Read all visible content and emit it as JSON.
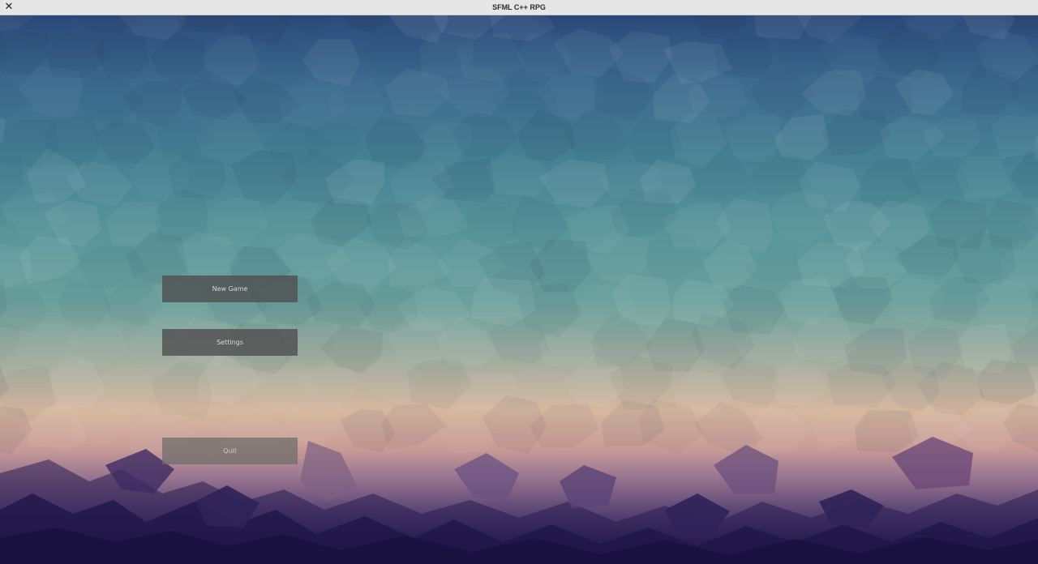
{
  "window": {
    "title": "SFML C++ RPG",
    "close_glyph": "✕",
    "close_icon": "close-icon"
  },
  "main_menu": {
    "buttons": [
      {
        "label": "New Game"
      },
      {
        "label": "Settings"
      },
      {
        "label": "Quit"
      }
    ]
  },
  "colors": {
    "titlebar_bg": "#e6e6e6",
    "button_bg": "#505050",
    "button_text": "#d8d8d8",
    "sky_top": "#2c4a7b",
    "sky_mid": "#5a9599",
    "horizon": "#d6b7a0",
    "ground_bottom": "#1e1646"
  }
}
